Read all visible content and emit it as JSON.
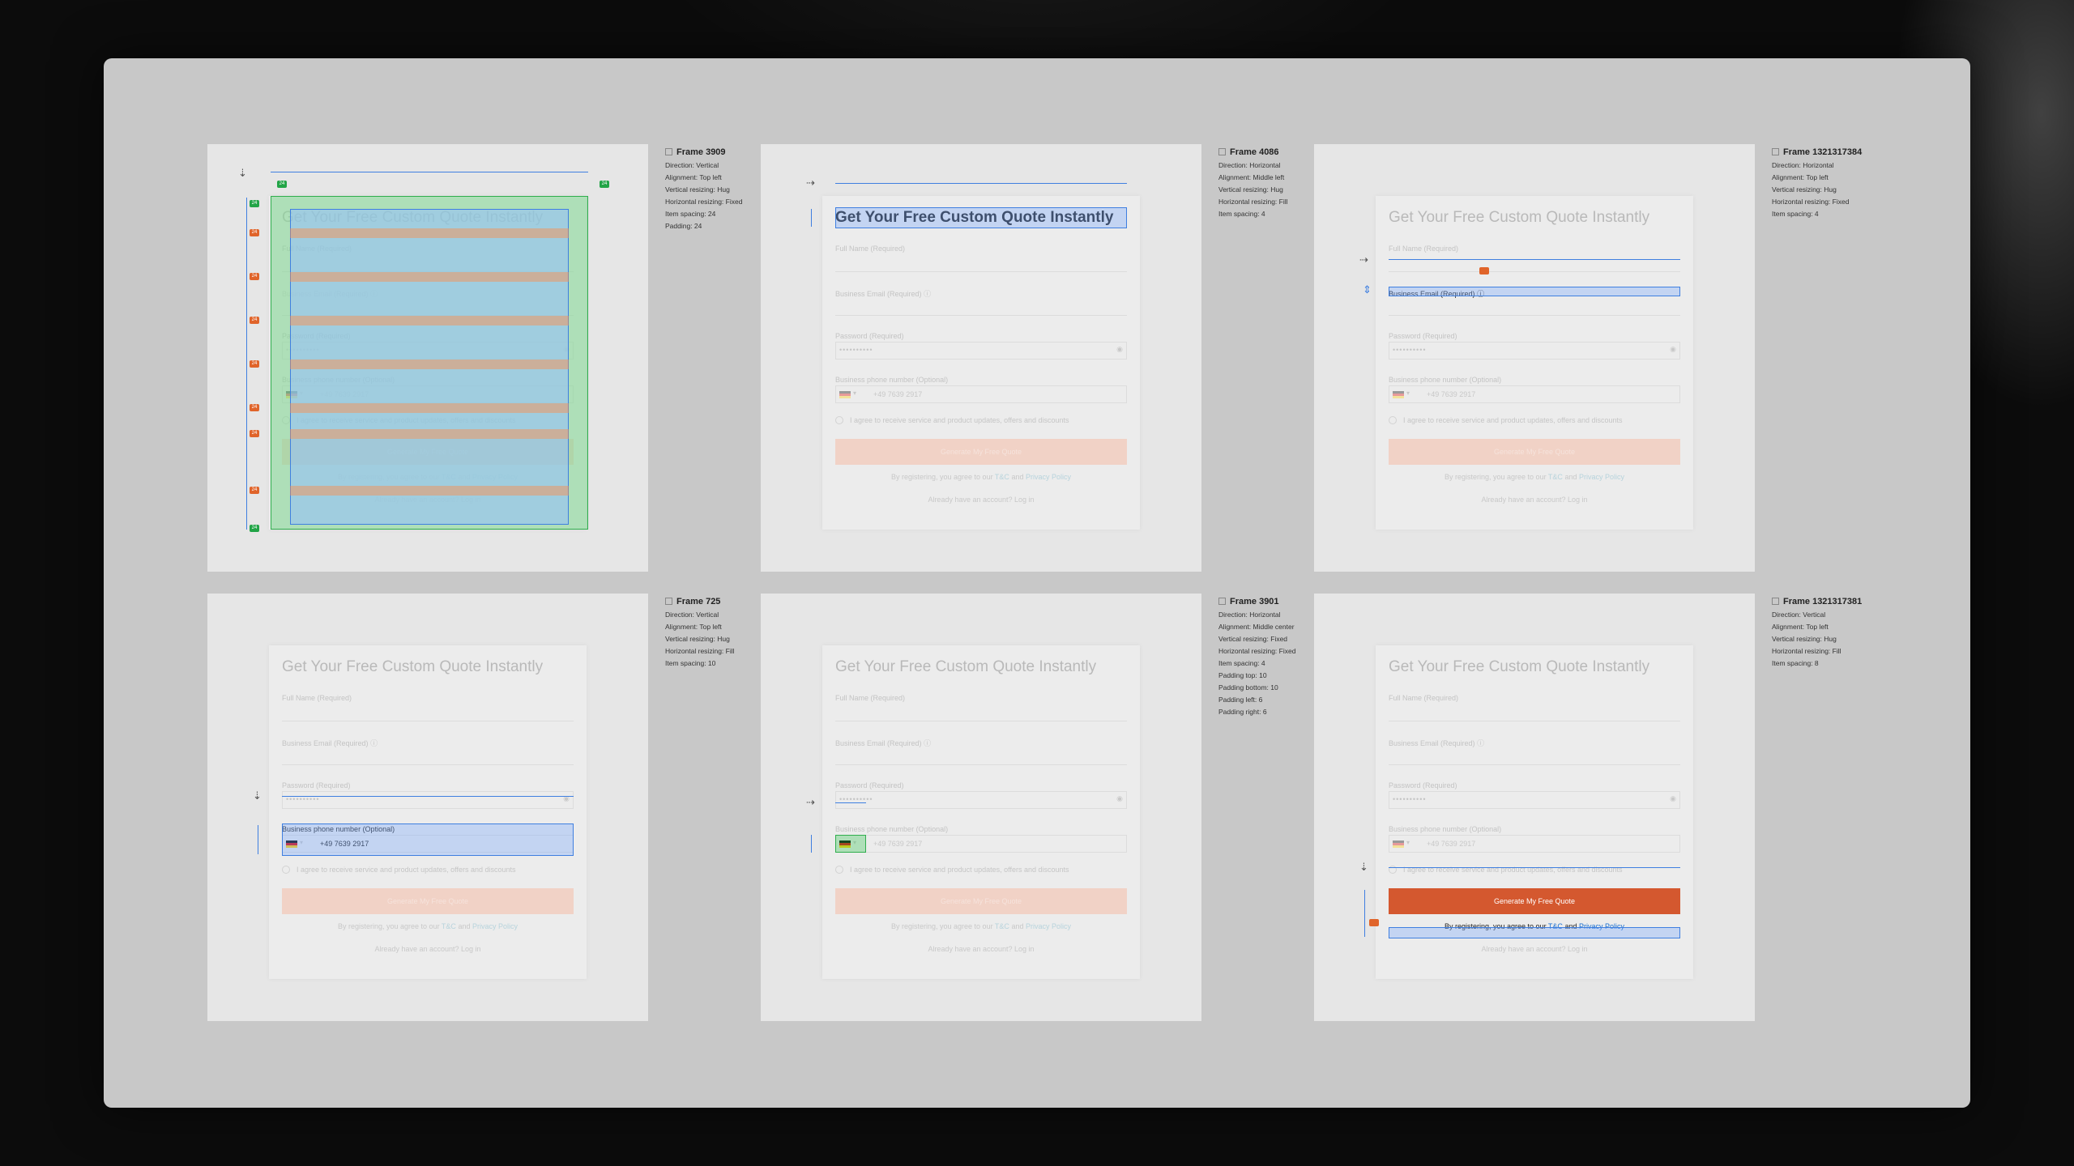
{
  "form": {
    "title": "Get Your Free Custom Quote Instantly",
    "full_name_label": "Full Name (Required)",
    "email_label": "Business Email (Required)",
    "password_label": "Password (Required)",
    "password_value": "••••••••••",
    "phone_label": "Business phone number (Optional)",
    "phone_value": "+49 7639 2917",
    "consent_text": "I agree to receive service and product updates, offers and discounts",
    "submit_label": "Generate My Free Quote",
    "terms_prefix": "By registering, you agree to our",
    "terms_link": "T&C",
    "terms_and": "and",
    "privacy_link": "Privacy Policy",
    "login_prompt": "Already have an account?",
    "login_link": "Log in"
  },
  "frames": [
    {
      "name": "Frame 3909",
      "props": [
        "Direction: Vertical",
        "Alignment: Top left",
        "Vertical resizing: Hug",
        "Horizontal resizing: Fixed",
        "Item spacing: 24",
        "Padding: 24"
      ]
    },
    {
      "name": "Frame 4086",
      "props": [
        "Direction: Horizontal",
        "Alignment: Middle left",
        "Vertical resizing: Hug",
        "Horizontal resizing: Fill",
        "Item spacing: 4"
      ]
    },
    {
      "name": "Frame 1321317384",
      "props": [
        "Direction: Horizontal",
        "Alignment: Top left",
        "Vertical resizing: Hug",
        "Horizontal resizing: Fixed",
        "Item spacing: 4"
      ]
    },
    {
      "name": "Frame 725",
      "props": [
        "Direction: Vertical",
        "Alignment: Top left",
        "Vertical resizing: Hug",
        "Horizontal resizing: Fill",
        "Item spacing: 10"
      ]
    },
    {
      "name": "Frame 3901",
      "props": [
        "Direction: Horizontal",
        "Alignment: Middle center",
        "Vertical resizing: Fixed",
        "Horizontal resizing: Fixed",
        "Item spacing: 4",
        "Padding top: 10",
        "Padding bottom: 10",
        "Padding left: 6",
        "Padding right: 6"
      ]
    },
    {
      "name": "Frame 1321317381",
      "props": [
        "Direction: Vertical",
        "Alignment: Top left",
        "Vertical resizing: Hug",
        "Horizontal resizing: Fill",
        "Item spacing: 8"
      ]
    }
  ],
  "spacing_badges": {
    "padding": "24",
    "gap": "24"
  },
  "icons": {
    "frame": "frame-icon",
    "vertical_flow": "vertical-direction-icon",
    "horizontal_flow": "horizontal-direction-icon",
    "eye": "eye-icon",
    "info": "info-icon"
  },
  "colors": {
    "accent": "#D4582F",
    "selection": "#3F7FE0",
    "padding": "#22A447",
    "gap": "#E0642A"
  }
}
